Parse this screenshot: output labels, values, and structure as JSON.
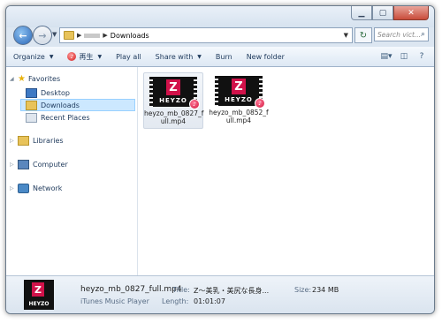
{
  "address": {
    "current_folder": "Downloads"
  },
  "search": {
    "placeholder": "Search vict..."
  },
  "toolbar": {
    "organize": "Organize",
    "play": "再生",
    "play_all": "Play all",
    "share_with": "Share with",
    "burn": "Burn",
    "new_folder": "New folder"
  },
  "sidebar": {
    "favorites": "Favorites",
    "desktop": "Desktop",
    "downloads": "Downloads",
    "recent_places": "Recent Places",
    "libraries": "Libraries",
    "computer": "Computer",
    "network": "Network"
  },
  "files": [
    {
      "name_line1": "heyzo_mb_0827_f",
      "name_line2": "ull.mp4",
      "thumb_text": "HEYZO"
    },
    {
      "name_line1": "heyzo_mb_0852_f",
      "name_line2": "ull.mp4",
      "thumb_text": "HEYZO"
    }
  ],
  "details": {
    "filename": "heyzo_mb_0827_full.mp4",
    "app": "iTunes Music Player",
    "title_label": "Title:",
    "title_value": "Z～美乳・美尻な長身...",
    "length_label": "Length:",
    "length_value": "01:01:07",
    "size_label": "Size:",
    "size_value": "234 MB",
    "thumb_text": "HEYZO"
  },
  "colors": {
    "accent": "#d1124a",
    "selection": "#cce8ff"
  }
}
